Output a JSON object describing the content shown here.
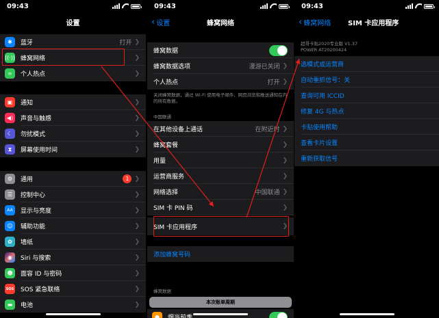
{
  "status": {
    "time": "09:43"
  },
  "settings": {
    "title": "设置",
    "bluetooth": {
      "label": "蓝牙",
      "value": "打开"
    },
    "cellular": {
      "label": "蜂窝网络"
    },
    "hotspot": {
      "label": "个人热点"
    },
    "notifications": {
      "label": "通知"
    },
    "sounds": {
      "label": "声音与触感"
    },
    "dnd": {
      "label": "勿扰模式"
    },
    "screentime": {
      "label": "屏幕使用时间"
    },
    "general": {
      "label": "通用",
      "badge": "1"
    },
    "control": {
      "label": "控制中心"
    },
    "display": {
      "label": "显示与亮度"
    },
    "accessibility": {
      "label": "辅助功能"
    },
    "wallpaper": {
      "label": "墙纸"
    },
    "siri": {
      "label": "Siri 与搜索"
    },
    "faceid": {
      "label": "面容 ID 与密码"
    },
    "sos": {
      "label": "SOS 紧急联络"
    },
    "battery": {
      "label": "电池"
    }
  },
  "cellular": {
    "back": "设置",
    "title": "蜂窝网络",
    "cellular_data": {
      "label": "蜂窝数据"
    },
    "data_options": {
      "label": "蜂窝数据选项",
      "value": "漫游已关闭"
    },
    "hotspot": {
      "label": "个人热点",
      "value": "打开"
    },
    "footer": "关闭蜂窝数据，通过 Wi-Fi 使用电子邮件、网页浏览和推送通知在内的所有数据。",
    "carrier_header": "中国联通",
    "calls_other": {
      "label": "在其他设备上通话",
      "value": "在附近时"
    },
    "plans": {
      "label": "蜂窝套餐"
    },
    "usage": {
      "label": "用量"
    },
    "carrier_services": {
      "label": "运营商服务"
    },
    "network": {
      "label": "网络选择",
      "value": "中国联通"
    },
    "sim_pin": {
      "label": "SIM 卡 PIN 码"
    },
    "sim_apps": {
      "label": "SIM 卡应用程序"
    },
    "add_plan": "添加蜂窝号码",
    "data_header": "蜂窝数据",
    "billing": "本次账单周期",
    "last_row": {
      "label": "烟当前季"
    }
  },
  "simapps": {
    "back": "蜂窝网络",
    "title": "SIM 卡应用程序",
    "info1": "超哥卡贴2020专业版 V1.37",
    "info2": "POWER AT20200424",
    "items": [
      "选模式或运营商",
      "自动重抓信号：关",
      "查询可用 ICCID",
      "修复 4G 与热点",
      "卡贴使用帮助",
      "查看卡片设置",
      "重新获取信号"
    ]
  },
  "colors": {
    "accent": "#0a84ff",
    "toggle_on": "#34c759",
    "annotation": "#e0201c"
  }
}
